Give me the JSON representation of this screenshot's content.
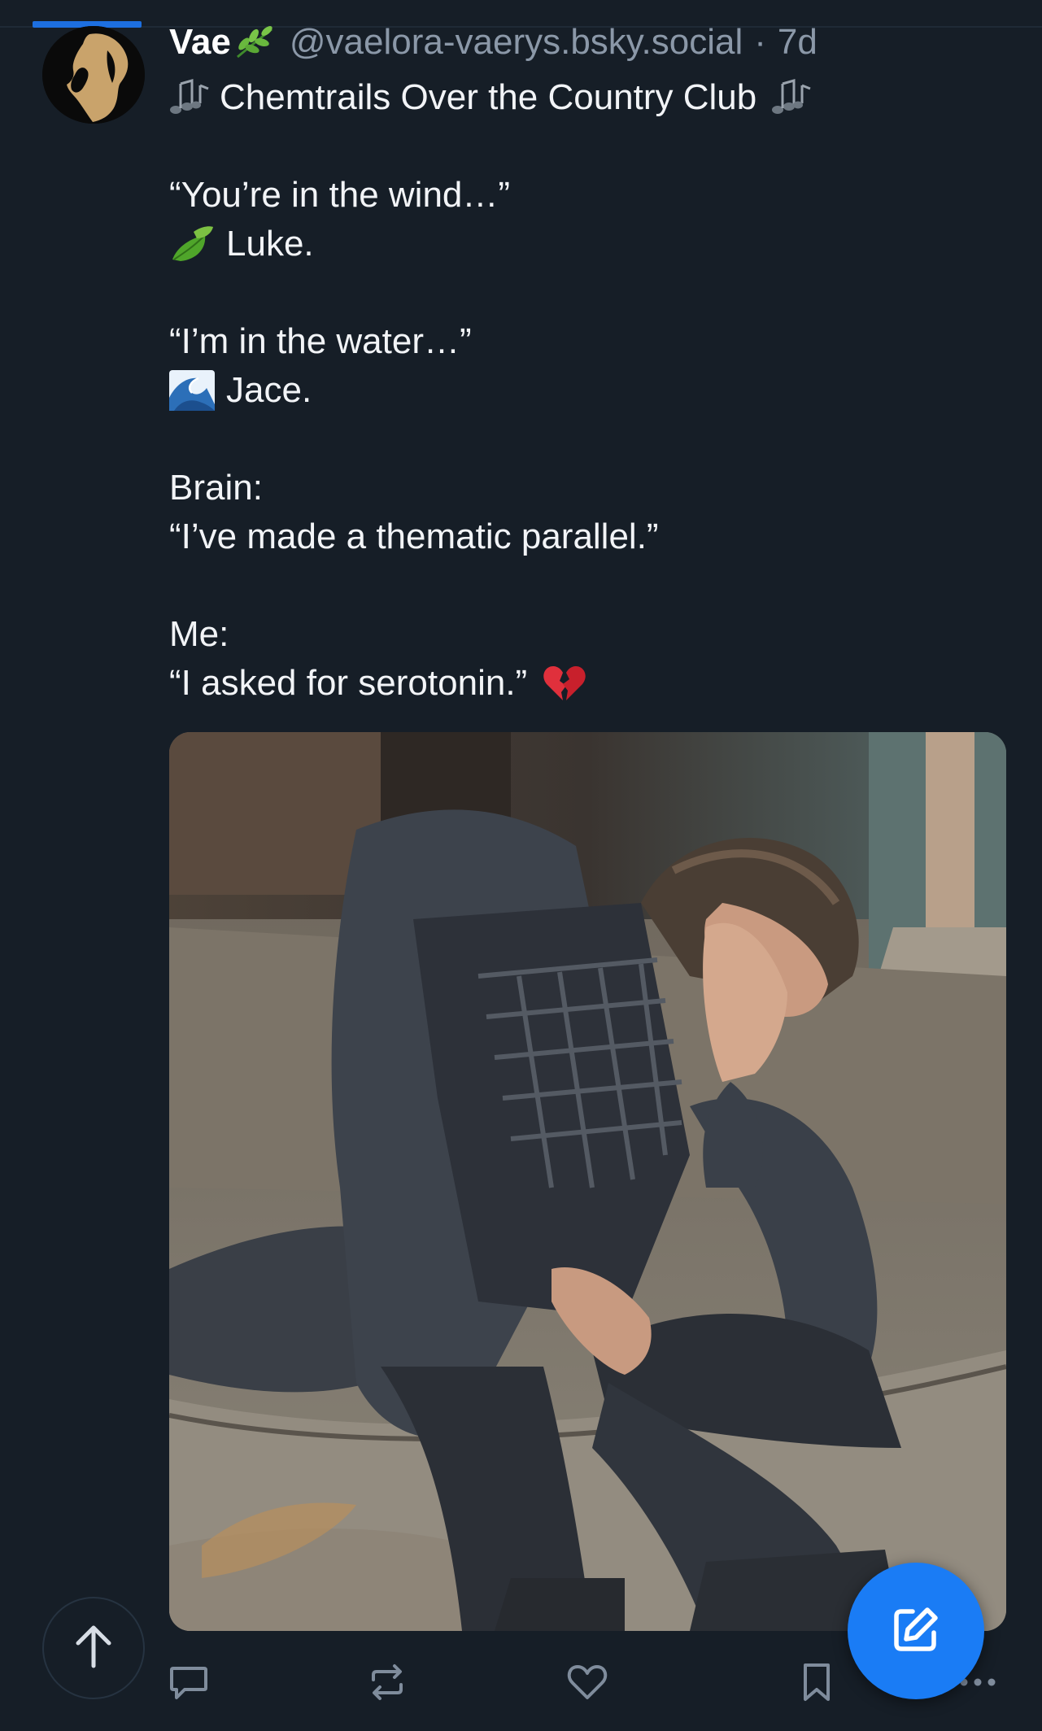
{
  "post": {
    "author": {
      "display_name": "Vae",
      "name_emoji": "herb-emoji",
      "handle": "@vaelora-vaerys.bsky.social",
      "separator": "·",
      "time": "7d"
    },
    "text": {
      "title": "Chemtrails Over the Country Club",
      "line_wind": "“You’re in the wind…”",
      "line_luke": "Luke.",
      "line_water": "“I’m in the water…”",
      "line_jace": "Jace.",
      "line_brain_label": "Brain:",
      "line_brain_quote": "“I’ve made a thematic parallel.”",
      "line_me_label": "Me:",
      "line_me_quote": "“I asked for serotonin.”"
    },
    "emojis": {
      "title_notes": "musical-notes-emoji",
      "luke": "leaf-fluttering-emoji",
      "jace": "water-wave-emoji",
      "heart": "broken-heart-emoji"
    },
    "media": {
      "kind": "photo",
      "subject": "man-sitting-on-steps-face-in-hand"
    }
  },
  "actions": [
    "reply-icon",
    "repost-icon",
    "like-icon",
    "bookmark-icon",
    "more-icon"
  ],
  "floating": {
    "scroll_top": "arrow-up-icon",
    "compose": "compose-icon"
  },
  "colors": {
    "background": "#161e27",
    "text": "#f2f4f7",
    "muted": "#8b98a8",
    "accent": "#1a7cf5",
    "action_icon": "#7f8c9c"
  }
}
